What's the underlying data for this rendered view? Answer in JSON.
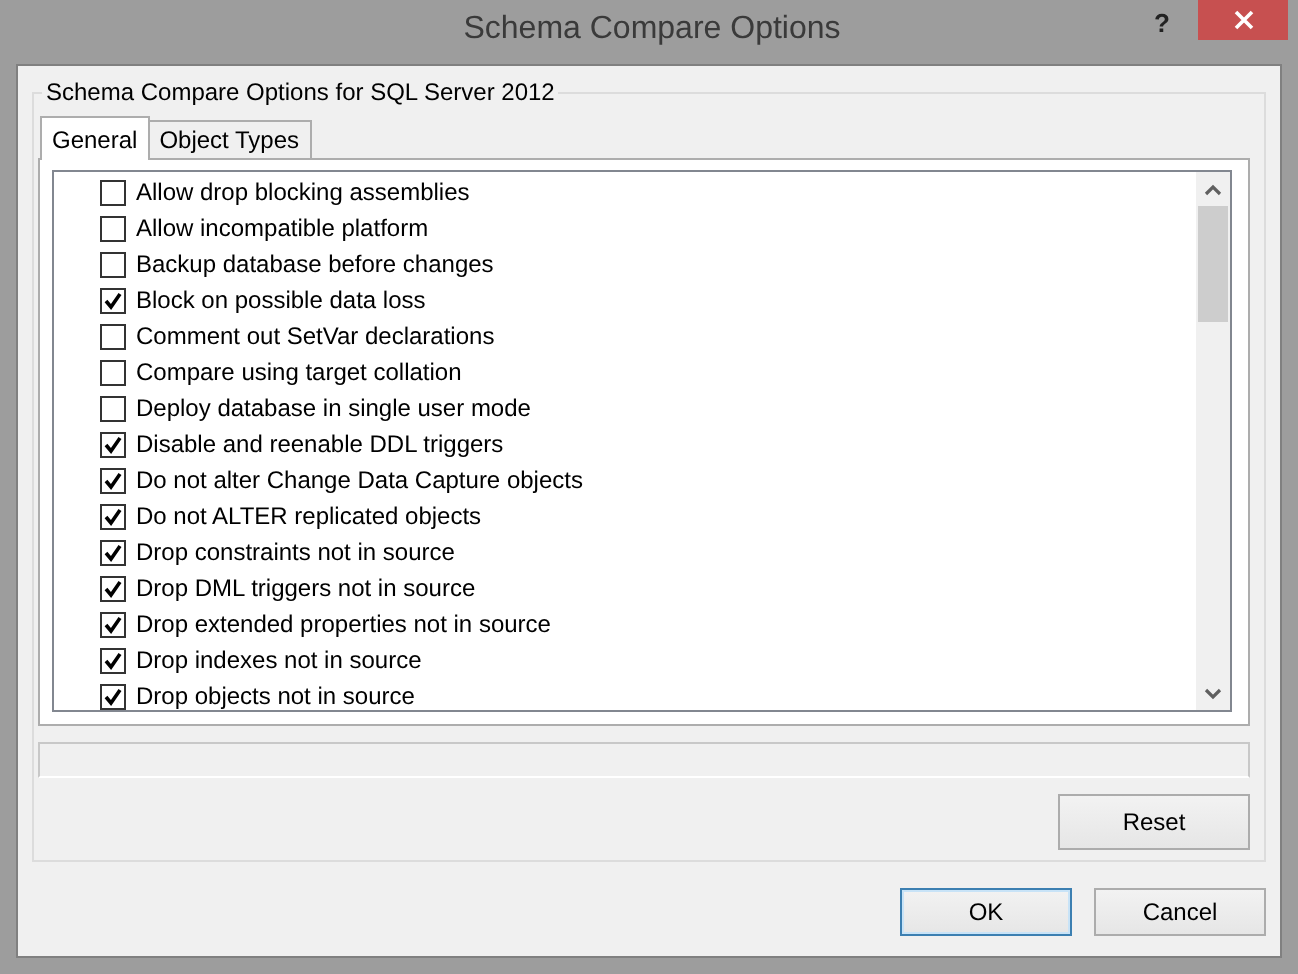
{
  "window": {
    "title": "Schema Compare Options",
    "help_button": "?"
  },
  "group_title": "Schema Compare Options for SQL Server 2012",
  "tabs": [
    {
      "label": "General",
      "selected": true
    },
    {
      "label": "Object Types",
      "selected": false
    }
  ],
  "options": [
    {
      "label": "Allow drop blocking assemblies",
      "checked": false
    },
    {
      "label": "Allow incompatible platform",
      "checked": false
    },
    {
      "label": "Backup database before changes",
      "checked": false
    },
    {
      "label": "Block on possible data loss",
      "checked": true
    },
    {
      "label": "Comment out SetVar declarations",
      "checked": false
    },
    {
      "label": "Compare using target collation",
      "checked": false
    },
    {
      "label": "Deploy database in single user mode",
      "checked": false
    },
    {
      "label": "Disable and reenable DDL triggers",
      "checked": true
    },
    {
      "label": "Do not alter Change Data Capture objects",
      "checked": true
    },
    {
      "label": "Do not ALTER replicated objects",
      "checked": true
    },
    {
      "label": "Drop constraints not in source",
      "checked": true
    },
    {
      "label": "Drop DML triggers not in source",
      "checked": true
    },
    {
      "label": "Drop extended properties not in source",
      "checked": true
    },
    {
      "label": "Drop indexes not in source",
      "checked": true
    },
    {
      "label": "Drop objects not in source",
      "checked": true
    }
  ],
  "reset_button": "Reset",
  "dialog_buttons": [
    {
      "label": "OK",
      "default": true
    },
    {
      "label": "Cancel",
      "default": false
    }
  ]
}
